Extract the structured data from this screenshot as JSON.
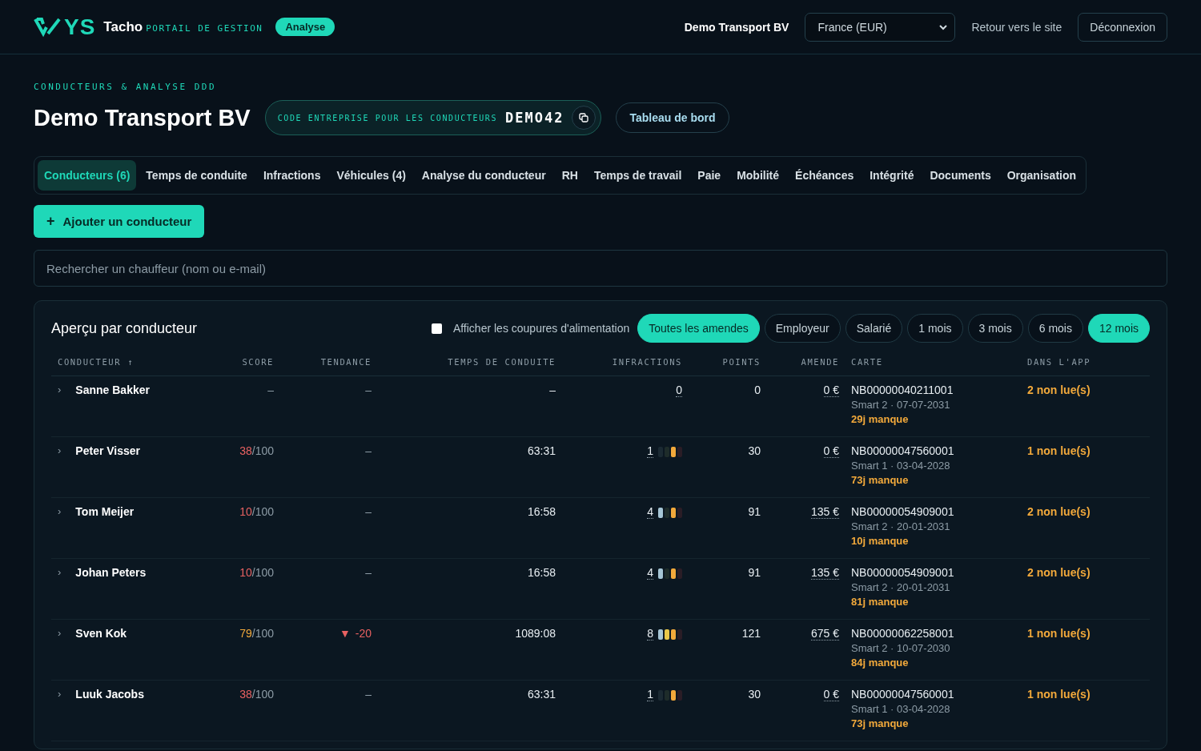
{
  "header": {
    "brand": "YS",
    "product": "Tacho",
    "subtitle": "PORTAIL DE GESTION",
    "badge": "Analyse",
    "company": "Demo Transport BV",
    "region": "France (EUR)",
    "back_link": "Retour vers le site",
    "logout": "Déconnexion"
  },
  "page": {
    "eyebrow": "CONDUCTEURS & ANALYSE DDD",
    "title": "Demo Transport BV",
    "code_label": "CODE ENTREPRISE POUR LES CONDUCTEURS",
    "code": "DEMO42",
    "dashboard_button": "Tableau de bord"
  },
  "tabs": [
    {
      "label": "Conducteurs (6)",
      "selected": true
    },
    {
      "label": "Temps de conduite",
      "selected": false
    },
    {
      "label": "Infractions",
      "selected": false
    },
    {
      "label": "Véhicules (4)",
      "selected": false
    },
    {
      "label": "Analyse du conducteur",
      "selected": false
    },
    {
      "label": "RH",
      "selected": false
    },
    {
      "label": "Temps de travail",
      "selected": false
    },
    {
      "label": "Paie",
      "selected": false
    },
    {
      "label": "Mobilité",
      "selected": false
    },
    {
      "label": "Échéances",
      "selected": false
    },
    {
      "label": "Intégrité",
      "selected": false
    },
    {
      "label": "Documents",
      "selected": false
    },
    {
      "label": "Organisation",
      "selected": false
    }
  ],
  "add_button": {
    "icon": "+",
    "label": "Ajouter un conducteur"
  },
  "search": {
    "placeholder": "Rechercher un chauffeur (nom ou e-mail)"
  },
  "overview": {
    "title": "Aperçu par conducteur",
    "power_cuts": {
      "label": "Afficher les coupures d'alimentation",
      "checked": false
    },
    "fine_filters": [
      {
        "label": "Toutes les amendes",
        "selected": true
      },
      {
        "label": "Employeur",
        "selected": false
      },
      {
        "label": "Salarié",
        "selected": false
      }
    ],
    "periods": [
      {
        "label": "1 mois",
        "selected": false
      },
      {
        "label": "3 mois",
        "selected": false
      },
      {
        "label": "6 mois",
        "selected": false
      },
      {
        "label": "12 mois",
        "selected": true
      }
    ],
    "columns": [
      {
        "label": "CONDUCTEUR",
        "sort": "↑"
      },
      {
        "label": "SCORE"
      },
      {
        "label": "TENDANCE"
      },
      {
        "label": "TEMPS DE CONDUITE"
      },
      {
        "label": "INFRACTIONS"
      },
      {
        "label": "POINTS"
      },
      {
        "label": "AMENDE"
      },
      {
        "label": "CARTE"
      },
      {
        "label": "DANS L'APP"
      }
    ],
    "rows": [
      {
        "chevron": "›",
        "name": "Sanne Bakker",
        "score": {
          "value": "–"
        },
        "trend": "–",
        "driving_time": "–",
        "infractions": "0",
        "points": "0",
        "fine": "0 €",
        "card": "NB00000040211001",
        "card_info": "Smart 2 · 07-07-2031",
        "card_missing": "29j manque",
        "app": "2 non lue(s)"
      },
      {
        "chevron": "›",
        "name": "Peter Visser",
        "score": {
          "value": "38",
          "max": "/100",
          "color": "#e86161"
        },
        "trend": "–",
        "driving_time": "63:31",
        "infractions": "1",
        "severity": [
          {
            "on": false
          },
          {
            "on": false
          },
          {
            "on": true
          },
          {
            "on": false
          }
        ],
        "points": "30",
        "fine": "0 €",
        "card": "NB00000047560001",
        "card_info": "Smart 1 · 03-04-2028",
        "card_missing": "73j manque",
        "app": "1 non lue(s)"
      },
      {
        "chevron": "›",
        "name": "Tom Meijer",
        "score": {
          "value": "10",
          "max": "/100",
          "color": "#e86161"
        },
        "trend": "–",
        "driving_time": "16:58",
        "infractions": "4",
        "severity": [
          {
            "on": true
          },
          {
            "on": false
          },
          {
            "on": true
          },
          {
            "on": false
          }
        ],
        "points": "91",
        "fine": "135 €",
        "card": "NB00000054909001",
        "card_info": "Smart 2 · 20-01-2031",
        "card_missing": "10j manque",
        "app": "2 non lue(s)"
      },
      {
        "chevron": "›",
        "name": "Johan Peters",
        "score": {
          "value": "10",
          "max": "/100",
          "color": "#e86161"
        },
        "trend": "–",
        "driving_time": "16:58",
        "infractions": "4",
        "severity": [
          {
            "on": true
          },
          {
            "on": false
          },
          {
            "on": true
          },
          {
            "on": false
          }
        ],
        "points": "91",
        "fine": "135 €",
        "card": "NB00000054909001",
        "card_info": "Smart 2 · 20-01-2031",
        "card_missing": "81j manque",
        "app": "2 non lue(s)"
      },
      {
        "chevron": "›",
        "name": "Sven Kok",
        "score": {
          "value": "79",
          "max": "/100",
          "color": "#f2a93b"
        },
        "trend_icon": "▼",
        "trend": "-20",
        "trend_down": true,
        "driving_time": "1089:08",
        "infractions": "8",
        "severity": [
          {
            "on": true
          },
          {
            "on": true
          },
          {
            "on": true
          },
          {
            "on": false
          }
        ],
        "points": "121",
        "fine": "675 €",
        "card": "NB00000062258001",
        "card_info": "Smart 2 · 10-07-2030",
        "card_missing": "84j manque",
        "app": "1 non lue(s)"
      },
      {
        "chevron": "›",
        "name": "Luuk Jacobs",
        "score": {
          "value": "38",
          "max": "/100",
          "color": "#e86161"
        },
        "trend": "–",
        "driving_time": "63:31",
        "infractions": "1",
        "severity": [
          {
            "on": false
          },
          {
            "on": false
          },
          {
            "on": true
          },
          {
            "on": false
          }
        ],
        "points": "30",
        "fine": "0 €",
        "card": "NB00000047560001",
        "card_info": "Smart 1 · 03-04-2028",
        "card_missing": "73j manque",
        "app": "1 non lue(s)"
      }
    ]
  }
}
